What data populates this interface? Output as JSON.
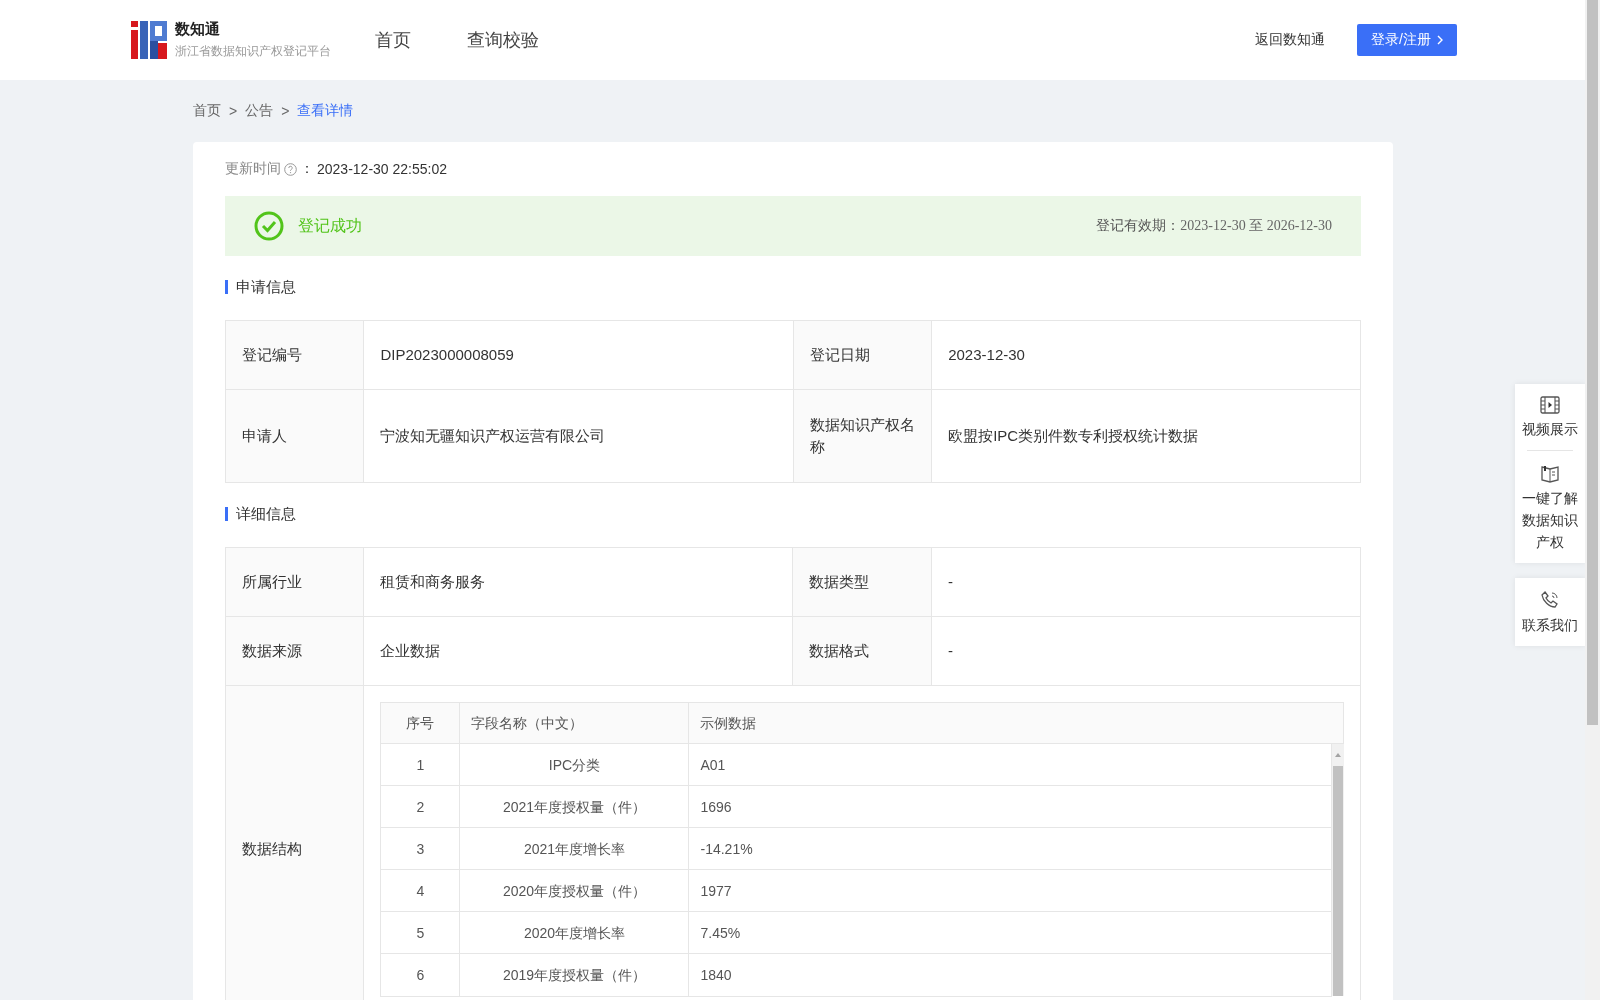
{
  "header": {
    "logo_title": "数知通",
    "logo_subtitle": "浙江省数据知识产权登记平台",
    "nav": [
      "首页",
      "查询校验"
    ],
    "back_link": "返回数知通",
    "login_button": "登录/注册"
  },
  "breadcrumb": [
    {
      "label": "首页",
      "current": false
    },
    {
      "label": "公告",
      "current": false
    },
    {
      "label": "查看详情",
      "current": true
    }
  ],
  "separator": ">",
  "update": {
    "label": "更新时间",
    "colon": "：",
    "value": "2023-12-30 22:55:02"
  },
  "status": {
    "kind": "success",
    "text": "登记成功",
    "validity_label": "登记有效期：",
    "validity_value": "2023-12-30 至 2026-12-30"
  },
  "sections": [
    {
      "title": "申请信息",
      "rows": [
        [
          {
            "label": "登记编号",
            "value": "DIP2023000008059"
          },
          {
            "label": "登记日期",
            "value": "2023-12-30"
          }
        ],
        [
          {
            "label": "申请人",
            "value": "宁波知无疆知识产权运营有限公司"
          },
          {
            "label": "数据知识产权名称",
            "value": "欧盟按IPC类别件数专利授权统计数据"
          }
        ]
      ]
    },
    {
      "title": "详细信息",
      "rows": [
        [
          {
            "label": "所属行业",
            "value": "租赁和商务服务"
          },
          {
            "label": "数据类型",
            "value": "-"
          }
        ],
        [
          {
            "label": "数据来源",
            "value": "企业数据"
          },
          {
            "label": "数据格式",
            "value": "-"
          }
        ]
      ],
      "structure": {
        "label": "数据结构",
        "columns": [
          "序号",
          "字段名称（中文）",
          "示例数据"
        ],
        "rows": [
          [
            "1",
            "IPC分类",
            "A01"
          ],
          [
            "2",
            "2021年度授权量（件）",
            "1696"
          ],
          [
            "3",
            "2021年度增长率",
            "-14.21%"
          ],
          [
            "4",
            "2020年度授权量（件）",
            "1977"
          ],
          [
            "5",
            "2020年度增长率",
            "7.45%"
          ],
          [
            "6",
            "2019年度授权量（件）",
            "1840"
          ]
        ]
      }
    }
  ],
  "float_tools": [
    {
      "kind": "video",
      "label": "视频展示"
    },
    {
      "kind": "guide",
      "label": "一键了解数据知识产权"
    },
    {
      "kind": "contact",
      "label": "联系我们"
    }
  ]
}
